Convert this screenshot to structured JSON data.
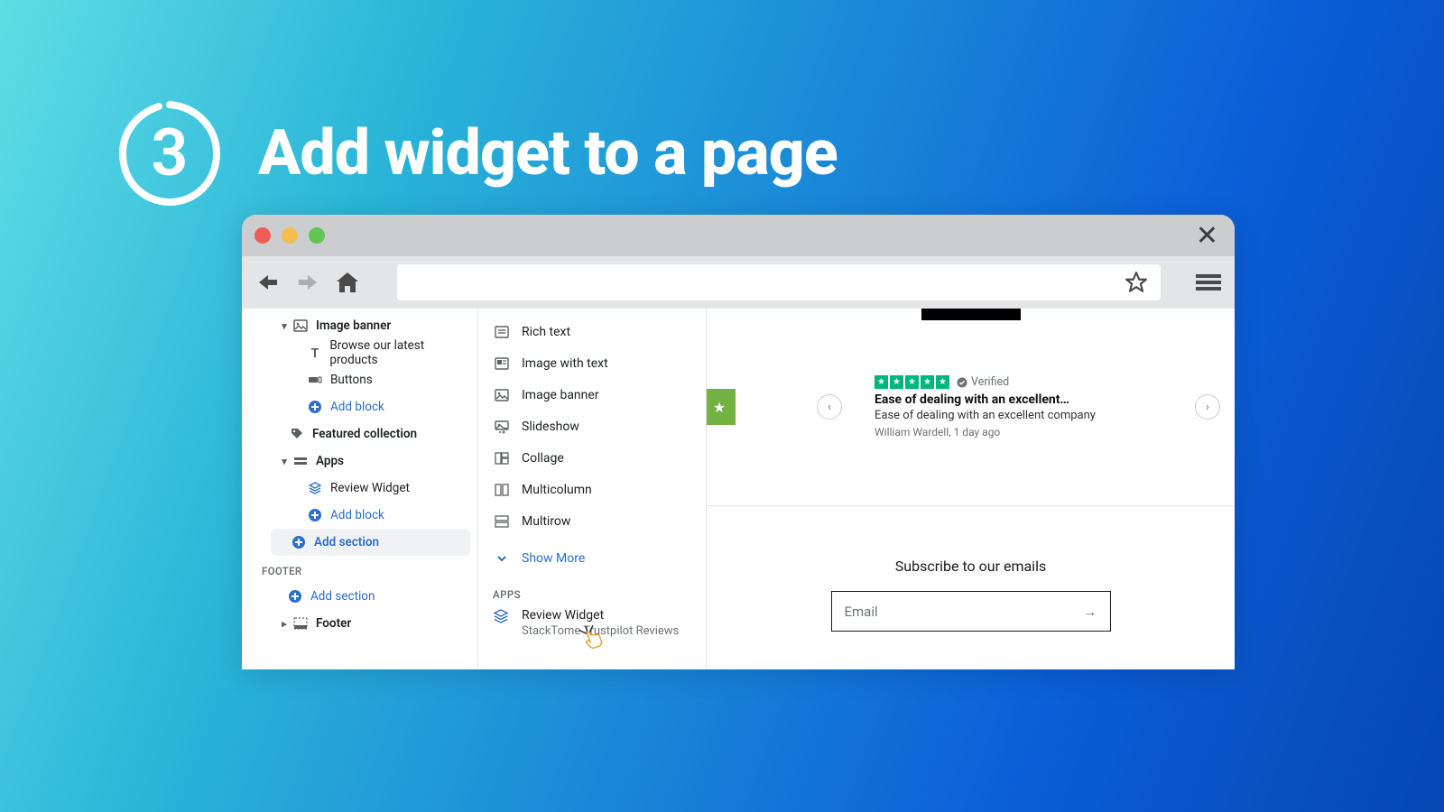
{
  "header": {
    "step_number": "3",
    "title": "Add widget to a page"
  },
  "browser": {
    "window_close": "✕"
  },
  "sidebar": {
    "image_banner": "Image banner",
    "browse_products": "Browse our latest products",
    "buttons": "Buttons",
    "add_block1": "Add block",
    "featured_collection": "Featured collection",
    "apps": "Apps",
    "review_widget": "Review Widget",
    "add_block2": "Add block",
    "add_section_main": "Add section",
    "footer_heading": "FOOTER",
    "add_section_footer": "Add section",
    "footer": "Footer"
  },
  "picker": {
    "rich_text": "Rich text",
    "image_with_text": "Image with text",
    "image_banner": "Image banner",
    "slideshow": "Slideshow",
    "collage": "Collage",
    "multicolumn": "Multicolumn",
    "multirow": "Multirow",
    "show_more": "Show More",
    "apps_heading": "APPS",
    "app_name": "Review Widget",
    "app_provider": "StackTome Trustpilot Reviews"
  },
  "preview": {
    "stars": 5,
    "verified": "Verified",
    "review_title": "Ease of dealing with an excellent…",
    "review_text": "Ease of dealing with an excellent company",
    "review_author": "William Wardell, 1 day ago",
    "subscribe_heading": "Subscribe to our emails",
    "email_placeholder": "Email"
  }
}
